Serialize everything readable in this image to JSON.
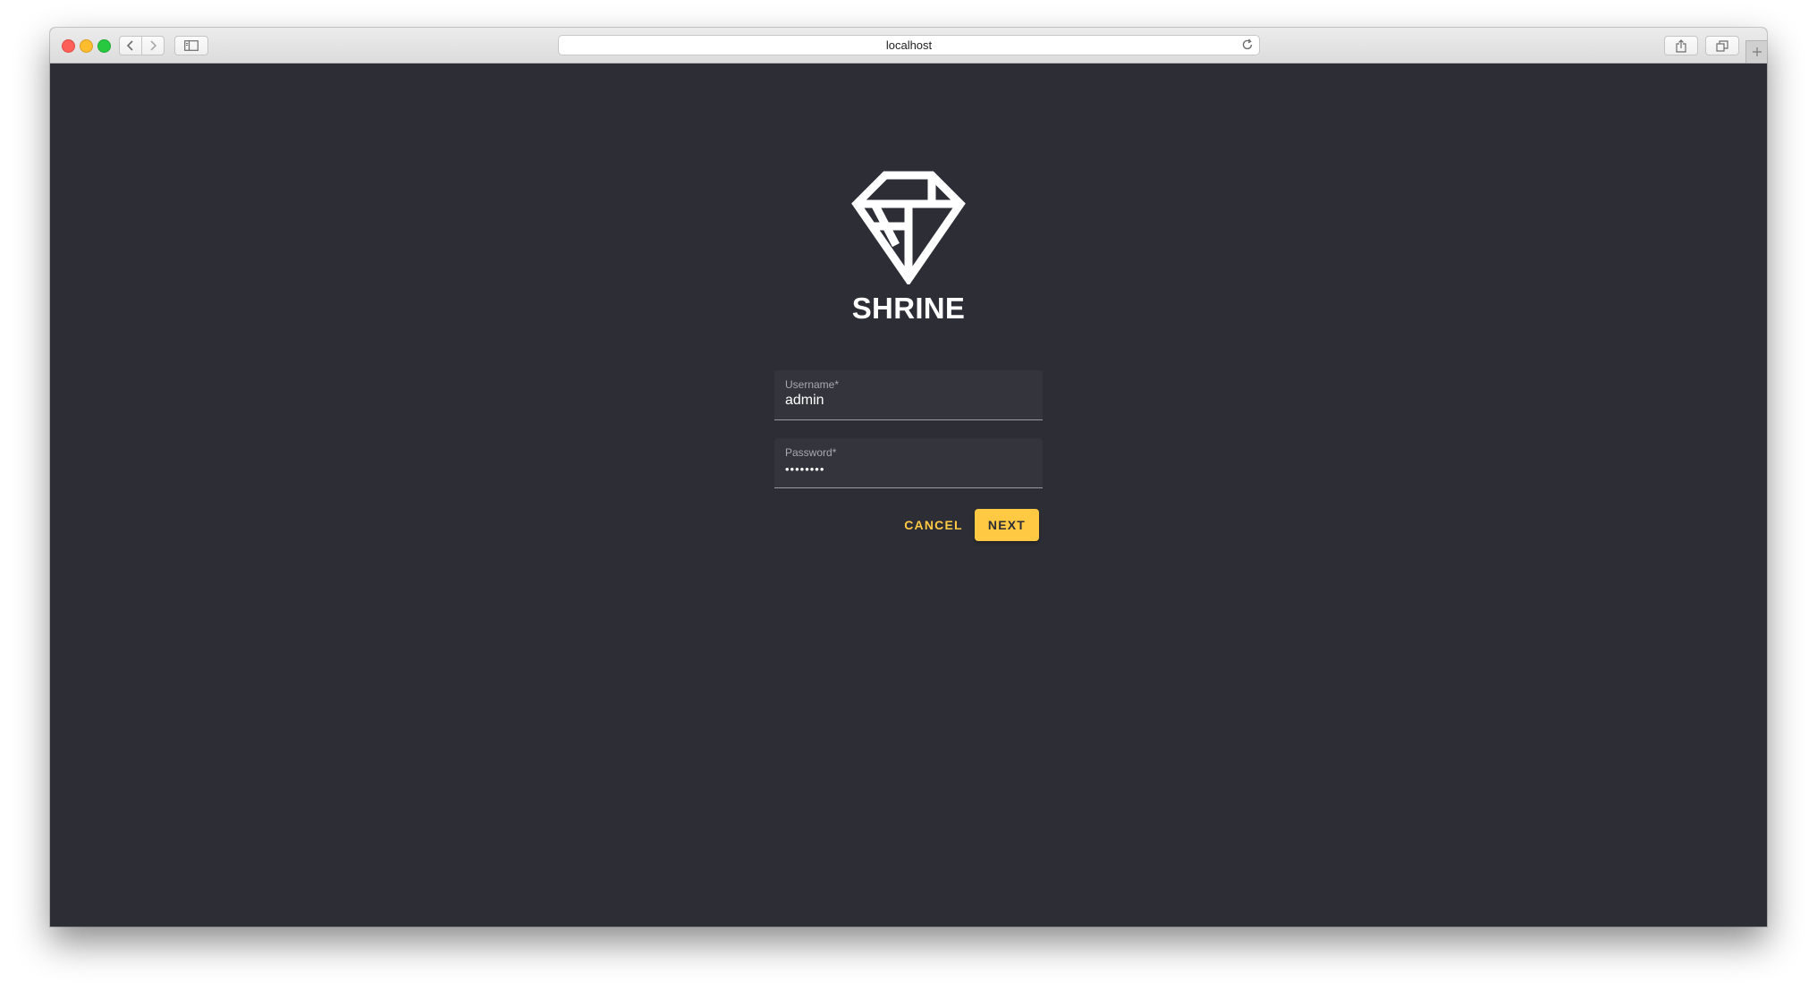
{
  "browser": {
    "url": "localhost",
    "icons": {
      "close": "close-dot",
      "minimize": "minimize-dot",
      "maximize": "maximize-dot",
      "back": "chevron-left-icon",
      "forward": "chevron-right-icon",
      "sidebar": "sidebar-icon",
      "reload": "reload-icon",
      "share": "share-icon",
      "tabs": "tabs-icon",
      "new_tab": "plus-icon"
    }
  },
  "app": {
    "brand": "SHRINE",
    "logo_icon": "diamond-icon",
    "username": {
      "label": "Username*",
      "value": "admin"
    },
    "password": {
      "label": "Password*",
      "value": "••••••••"
    },
    "cancel_label": "CANCEL",
    "next_label": "NEXT"
  },
  "colors": {
    "background": "#2d2d35",
    "field_bg": "#34343c",
    "accent": "#ffc943",
    "text": "#ffffff"
  }
}
